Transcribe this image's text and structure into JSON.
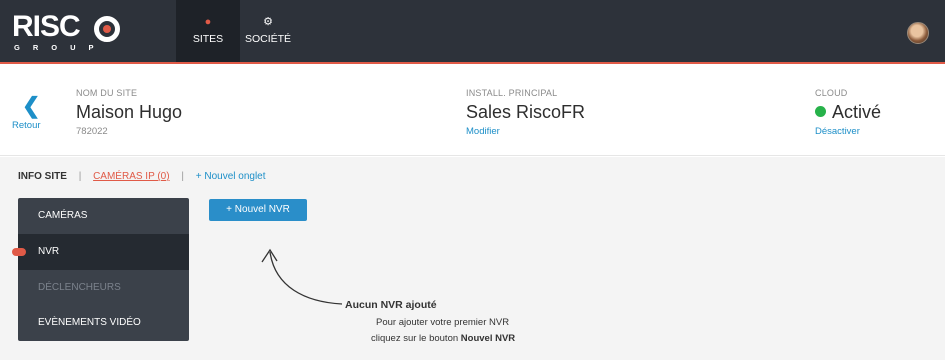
{
  "app": {
    "logo_main": "RISC",
    "logo_sub": "GROUP",
    "accent_color": "#e05a47",
    "topbar_color": "#2d323a",
    "link_color": "#1d8fc8",
    "button_color": "#2a8ec9",
    "status_color": "#27b24a"
  },
  "nav": {
    "items": [
      {
        "label": "SITES",
        "icon": "map-marker-icon",
        "active": true
      },
      {
        "label": "SOCIÉTÉ",
        "icon": "gear-icon",
        "active": false
      }
    ]
  },
  "user": {
    "avatar": "user-avatar"
  },
  "header": {
    "back_label": "Retour",
    "site": {
      "key": "NOM DU SITE",
      "value": "Maison Hugo",
      "sub": "782022"
    },
    "install": {
      "key": "INSTALL. PRINCIPAL",
      "value": "Sales RiscoFR",
      "link": "Modifier"
    },
    "cloud": {
      "key": "CLOUD",
      "value": "Activé",
      "link": "Désactiver"
    }
  },
  "tabs": {
    "info": "INFO SITE",
    "separator": "|",
    "cameras": "CAMÉRAS IP (0)",
    "new_tab": "+ Nouvel onglet"
  },
  "sidemenu": {
    "items": [
      {
        "label": "CAMÉRAS",
        "state": "normal"
      },
      {
        "label": "NVR",
        "state": "active"
      },
      {
        "label": "DÉCLENCHEURS",
        "state": "disabled"
      },
      {
        "label": "EVÈNEMENTS VIDÉO",
        "state": "normal"
      }
    ]
  },
  "main": {
    "new_nvr_button": "+ Nouvel NVR",
    "empty_title": "Aucun NVR ajouté",
    "empty_line1": "Pour ajouter votre premier NVR",
    "empty_line2_prefix": "cliquez sur le bouton ",
    "empty_line2_bold": "Nouvel NVR"
  }
}
